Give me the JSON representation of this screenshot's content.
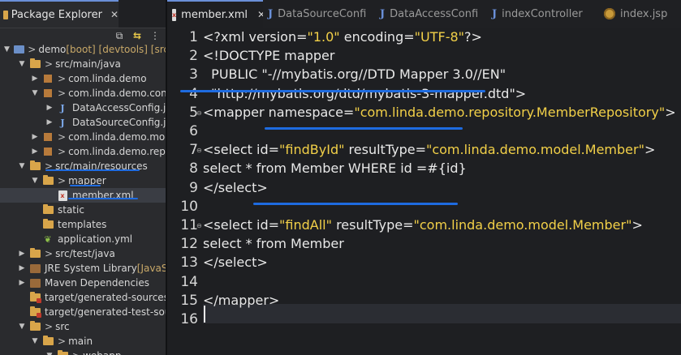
{
  "explorer": {
    "tab_label": "Package Explorer",
    "tab_close": "✕",
    "tools": [
      {
        "name": "collapse-all-icon",
        "glyph": "⧉"
      },
      {
        "name": "link-with-editor-icon",
        "glyph": "⇆"
      },
      {
        "name": "view-menu-icon",
        "glyph": "⋮"
      }
    ],
    "tree": [
      {
        "label": "demo",
        "suffix": "[boot] [devtools] [src",
        "depth": 0,
        "twisty": "▼",
        "icon": "project"
      },
      {
        "label": "src/main/java",
        "depth": 1,
        "twisty": "▼",
        "icon": "srcfolder"
      },
      {
        "label": "com.linda.demo",
        "depth": 2,
        "twisty": "▶",
        "icon": "package"
      },
      {
        "label": "com.linda.demo.confi",
        "depth": 2,
        "twisty": "▼",
        "icon": "package"
      },
      {
        "label": "DataAccessConfig.jav",
        "depth": 3,
        "twisty": "▶",
        "icon": "java"
      },
      {
        "label": "DataSourceConfig.jav",
        "depth": 3,
        "twisty": "▶",
        "icon": "java"
      },
      {
        "label": "com.linda.demo.mode",
        "depth": 2,
        "twisty": "▶",
        "icon": "package"
      },
      {
        "label": "com.linda.demo.repos",
        "depth": 2,
        "twisty": "▶",
        "icon": "package"
      },
      {
        "label": "src/main/resources",
        "depth": 1,
        "twisty": "▼",
        "icon": "srcfolder"
      },
      {
        "label": "mapper",
        "depth": 2,
        "twisty": "▼",
        "icon": "folder"
      },
      {
        "label": "member.xml",
        "depth": 3,
        "twisty": "",
        "icon": "xml",
        "selected": true
      },
      {
        "label": "static",
        "depth": 2,
        "twisty": "",
        "icon": "folder"
      },
      {
        "label": "templates",
        "depth": 2,
        "twisty": "",
        "icon": "folder"
      },
      {
        "label": "application.yml",
        "depth": 2,
        "twisty": "",
        "icon": "yml"
      },
      {
        "label": "src/test/java",
        "depth": 1,
        "twisty": "▶",
        "icon": "srcfolder"
      },
      {
        "label": "JRE System Library",
        "suffix": "[JavaSE-",
        "depth": 1,
        "twisty": "▶",
        "icon": "lib"
      },
      {
        "label": "Maven Dependencies",
        "depth": 1,
        "twisty": "▶",
        "icon": "lib"
      },
      {
        "label": "target/generated-sources/a",
        "depth": 1,
        "twisty": "",
        "icon": "srcfolder-red"
      },
      {
        "label": "target/generated-test-sourc",
        "depth": 1,
        "twisty": "",
        "icon": "srcfolder-red"
      },
      {
        "label": "src",
        "depth": 1,
        "twisty": "▼",
        "icon": "folder"
      },
      {
        "label": "main",
        "depth": 2,
        "twisty": "▼",
        "icon": "folder"
      },
      {
        "label": "webapp",
        "depth": 3,
        "twisty": "▼",
        "icon": "folder"
      }
    ]
  },
  "editor": {
    "tabs": [
      {
        "label": "member.xml",
        "icon": "xml",
        "active": true,
        "close": "✕"
      },
      {
        "label": "DataSourceConfi",
        "icon": "java"
      },
      {
        "label": "DataAccessConfi",
        "icon": "java"
      },
      {
        "label": "indexController",
        "icon": "java"
      },
      {
        "label": "index.jsp",
        "icon": "jsp"
      }
    ],
    "lines": [
      {
        "n": "1",
        "segs": [
          [
            "<?xml version=",
            ""
          ],
          [
            "\"1.0\"",
            "val"
          ],
          [
            " encoding=",
            ""
          ],
          [
            "\"UTF-8\"",
            "val"
          ],
          [
            "?>",
            ""
          ]
        ]
      },
      {
        "n": "2",
        "segs": [
          [
            "<!DOCTYPE mapper",
            ""
          ]
        ]
      },
      {
        "n": "3",
        "segs": [
          [
            "  PUBLIC \"-//mybatis.org//DTD Mapper 3.0//EN\"",
            ""
          ]
        ]
      },
      {
        "n": "4",
        "segs": [
          [
            "  \"http://mybatis.org/dtd/mybatis-3-mapper.dtd\">",
            ""
          ]
        ]
      },
      {
        "n": "5",
        "fold": true,
        "segs": [
          [
            "<mapper namespace=",
            ""
          ],
          [
            "\"com.linda.demo.repository.MemberRepository\"",
            "val"
          ],
          [
            ">",
            ""
          ]
        ]
      },
      {
        "n": "6",
        "segs": []
      },
      {
        "n": "7",
        "fold": true,
        "segs": [
          [
            "<select id=",
            ""
          ],
          [
            "\"findById\"",
            "val"
          ],
          [
            " resultType=",
            ""
          ],
          [
            "\"com.linda.demo.model.Member\"",
            "val"
          ],
          [
            ">",
            ""
          ]
        ]
      },
      {
        "n": "8",
        "segs": [
          [
            "select * from Member WHERE id =#{id}",
            ""
          ]
        ]
      },
      {
        "n": "9",
        "segs": [
          [
            "</select>",
            ""
          ]
        ]
      },
      {
        "n": "10",
        "segs": []
      },
      {
        "n": "11",
        "fold": true,
        "segs": [
          [
            "<select id=",
            ""
          ],
          [
            "\"findAll\"",
            "val"
          ],
          [
            " resultType=",
            ""
          ],
          [
            "\"com.linda.demo.model.Member\"",
            "val"
          ],
          [
            ">",
            ""
          ]
        ]
      },
      {
        "n": "12",
        "segs": [
          [
            "select * from Member",
            ""
          ]
        ]
      },
      {
        "n": "13",
        "segs": [
          [
            "</select>",
            ""
          ]
        ]
      },
      {
        "n": "14",
        "segs": []
      },
      {
        "n": "15",
        "segs": [
          [
            "</mapper>",
            ""
          ]
        ]
      },
      {
        "n": "16",
        "segs": []
      }
    ]
  },
  "colors": {
    "annotation_underline": "#1e6be0",
    "attr_value": "#f2d048"
  }
}
